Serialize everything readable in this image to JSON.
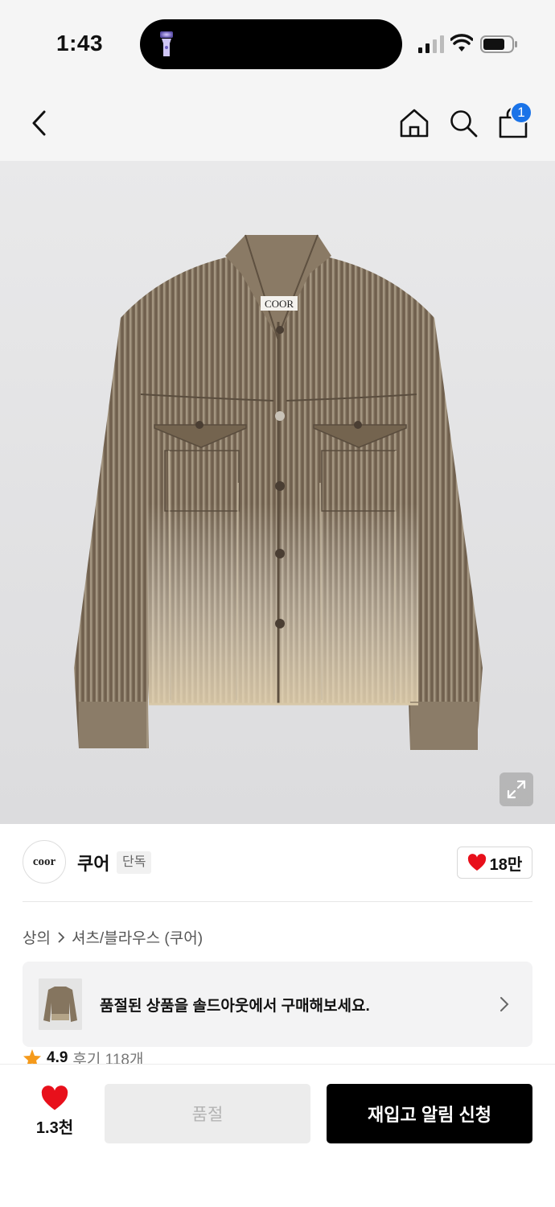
{
  "status_bar": {
    "time": "1:43"
  },
  "header": {
    "cart_count": "1"
  },
  "brand": {
    "logo_text": "coor",
    "name": "쿠어",
    "tag": "단독",
    "likes": "18만"
  },
  "breadcrumb": {
    "items": [
      "상의",
      "셔츠/블라우스 (쿠어)"
    ]
  },
  "soldout_banner": {
    "text": "품절된 상품을 솔드아웃에서 구매해보세요."
  },
  "rating": {
    "score": "4.9",
    "reviews": "후기 118개"
  },
  "bottom_bar": {
    "like_count": "1.3천",
    "soldout_label": "품절",
    "restock_label": "재입고 알림 신청"
  },
  "product_image": {
    "label_text": "COOR"
  },
  "colors": {
    "accent_blue": "#1a73e8",
    "heart_red": "#e8101b",
    "star_orange": "#f59a1b"
  }
}
